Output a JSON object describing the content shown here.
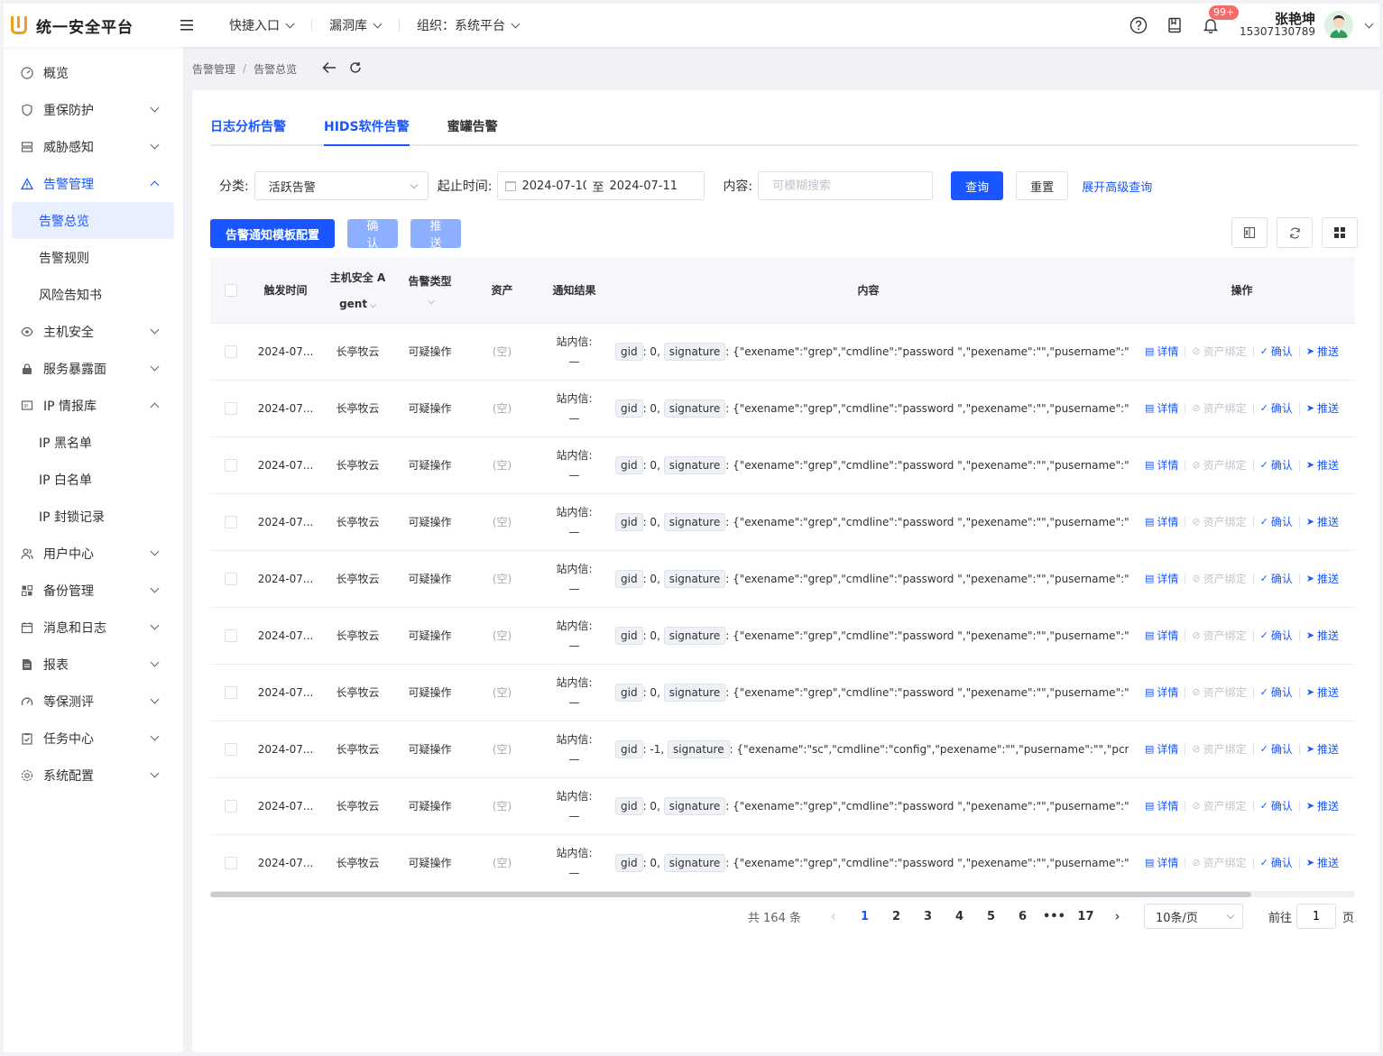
{
  "app": {
    "title": "统一安全平台",
    "brand_color": "#1a56ff",
    "logo_color": "#f0a020"
  },
  "topnav": [
    {
      "label": "快捷入口"
    },
    {
      "label": "漏洞库"
    },
    {
      "label": "组织：系统平台"
    }
  ],
  "header": {
    "notification_badge": "99+",
    "user_name": "张艳坤",
    "user_phone": "15307130789"
  },
  "sidebar": {
    "items": [
      {
        "label": "概览",
        "icon": "dashboard-icon"
      },
      {
        "label": "重保防护",
        "icon": "shield-icon"
      },
      {
        "label": "威胁感知",
        "icon": "server-icon"
      },
      {
        "label": "告警管理",
        "icon": "warning-icon"
      },
      {
        "label": "告警总览"
      },
      {
        "label": "告警规则"
      },
      {
        "label": "风险告知书"
      },
      {
        "label": "主机安全",
        "icon": "eye-icon"
      },
      {
        "label": "服务暴露面",
        "icon": "lock-icon"
      },
      {
        "label": "IP 情报库",
        "icon": "ip-icon"
      },
      {
        "label": "IP 黑名单"
      },
      {
        "label": "IP 白名单"
      },
      {
        "label": "IP 封锁记录"
      },
      {
        "label": "用户中心",
        "icon": "users-icon"
      },
      {
        "label": "备份管理",
        "icon": "backup-icon"
      },
      {
        "label": "消息和日志",
        "icon": "calendar-icon"
      },
      {
        "label": "报表",
        "icon": "report-icon"
      },
      {
        "label": "等保测评",
        "icon": "gauge-icon"
      },
      {
        "label": "任务中心",
        "icon": "clipboard-icon"
      },
      {
        "label": "系统配置",
        "icon": "settings-icon"
      }
    ]
  },
  "breadcrumb": [
    "告警管理",
    "告警总览"
  ],
  "tabs": [
    {
      "label": "日志分析告警"
    },
    {
      "label": "HIDS软件告警"
    },
    {
      "label": "蜜罐告警"
    }
  ],
  "filters": {
    "category_label": "分类:",
    "category_value": "活跃告警",
    "time_label": "起止时间:",
    "start_date": "2024-07-10",
    "to_label": "至",
    "end_date": "2024-07-11",
    "content_label": "内容:",
    "content_placeholder": "可模糊搜索",
    "query_btn": "查询",
    "reset_btn": "重置",
    "advanced_link": "展开高级查询"
  },
  "toolbar": {
    "template_btn": "告警通知模板配置",
    "confirm_btn": "确认",
    "push_btn": "推送"
  },
  "table": {
    "headers": {
      "time": "触发时间",
      "agent_line1": "主机安全 A",
      "agent_line2": "gent",
      "type": "告警类型",
      "asset": "资产",
      "notify": "通知结果",
      "content": "内容",
      "ops": "操作"
    },
    "op_labels": {
      "detail": "详情",
      "bind": "资产绑定",
      "confirm": "确认",
      "push": "推送"
    },
    "rows": [
      {
        "time": "2024-07...",
        "agent": "长亭牧云",
        "type": "可疑操作",
        "asset": "(空)",
        "notify1": "站内信:",
        "notify2": "—",
        "gid": "gid",
        "gid_val": ": 0,",
        "sig": "signature",
        "content": ": {\"exename\":\"grep\",\"cmdline\":\"password \",\"pexename\":\"\",\"pusername\":\"\",\"pcmdline\":\"\","
      },
      {
        "time": "2024-07...",
        "agent": "长亭牧云",
        "type": "可疑操作",
        "asset": "(空)",
        "notify1": "站内信:",
        "notify2": "—",
        "gid": "gid",
        "gid_val": ": 0,",
        "sig": "signature",
        "content": ": {\"exename\":\"grep\",\"cmdline\":\"password \",\"pexename\":\"\",\"pusername\":\"\",\"pcmdline\":\"\","
      },
      {
        "time": "2024-07...",
        "agent": "长亭牧云",
        "type": "可疑操作",
        "asset": "(空)",
        "notify1": "站内信:",
        "notify2": "—",
        "gid": "gid",
        "gid_val": ": 0,",
        "sig": "signature",
        "content": ": {\"exename\":\"grep\",\"cmdline\":\"password \",\"pexename\":\"\",\"pusername\":\"\",\"pcmdline\":\"\","
      },
      {
        "time": "2024-07...",
        "agent": "长亭牧云",
        "type": "可疑操作",
        "asset": "(空)",
        "notify1": "站内信:",
        "notify2": "—",
        "gid": "gid",
        "gid_val": ": 0,",
        "sig": "signature",
        "content": ": {\"exename\":\"grep\",\"cmdline\":\"password \",\"pexename\":\"\",\"pusername\":\"\",\"pcmdline\":\"\","
      },
      {
        "time": "2024-07...",
        "agent": "长亭牧云",
        "type": "可疑操作",
        "asset": "(空)",
        "notify1": "站内信:",
        "notify2": "—",
        "gid": "gid",
        "gid_val": ": 0,",
        "sig": "signature",
        "content": ": {\"exename\":\"grep\",\"cmdline\":\"password \",\"pexename\":\"\",\"pusername\":\"\",\"pcmdline\":\"\","
      },
      {
        "time": "2024-07...",
        "agent": "长亭牧云",
        "type": "可疑操作",
        "asset": "(空)",
        "notify1": "站内信:",
        "notify2": "—",
        "gid": "gid",
        "gid_val": ": 0,",
        "sig": "signature",
        "content": ": {\"exename\":\"grep\",\"cmdline\":\"password \",\"pexename\":\"\",\"pusername\":\"\",\"pcmdline\":\"\","
      },
      {
        "time": "2024-07...",
        "agent": "长亭牧云",
        "type": "可疑操作",
        "asset": "(空)",
        "notify1": "站内信:",
        "notify2": "—",
        "gid": "gid",
        "gid_val": ": 0,",
        "sig": "signature",
        "content": ": {\"exename\":\"grep\",\"cmdline\":\"password \",\"pexename\":\"\",\"pusername\":\"\",\"pcmdline\":\"\","
      },
      {
        "time": "2024-07...",
        "agent": "长亭牧云",
        "type": "可疑操作",
        "asset": "(空)",
        "notify1": "站内信:",
        "notify2": "—",
        "gid": "gid",
        "gid_val": ": -1,",
        "sig": "signature",
        "content": ": {\"exename\":\"sc\",\"cmdline\":\"config\",\"pexename\":\"\",\"pusername\":\"\",\"pcmdline\":\"\","
      },
      {
        "time": "2024-07...",
        "agent": "长亭牧云",
        "type": "可疑操作",
        "asset": "(空)",
        "notify1": "站内信:",
        "notify2": "—",
        "gid": "gid",
        "gid_val": ": 0,",
        "sig": "signature",
        "content": ": {\"exename\":\"grep\",\"cmdline\":\"password \",\"pexename\":\"\",\"pusername\":\"\",\"pcmdline\":\"\","
      },
      {
        "time": "2024-07...",
        "agent": "长亭牧云",
        "type": "可疑操作",
        "asset": "(空)",
        "notify1": "站内信:",
        "notify2": "—",
        "gid": "gid",
        "gid_val": ": 0,",
        "sig": "signature",
        "content": ": {\"exename\":\"grep\",\"cmdline\":\"password \",\"pexename\":\"\",\"pusername\":\"\",\"pcmdline\":\"\","
      }
    ]
  },
  "pagination": {
    "total": "共 164 条",
    "pages": [
      "1",
      "2",
      "3",
      "4",
      "5",
      "6",
      "•••",
      "17"
    ],
    "current": "1",
    "page_size": "10条/页",
    "goto_label": "前往",
    "goto_value": "1",
    "page_suffix": "页"
  }
}
